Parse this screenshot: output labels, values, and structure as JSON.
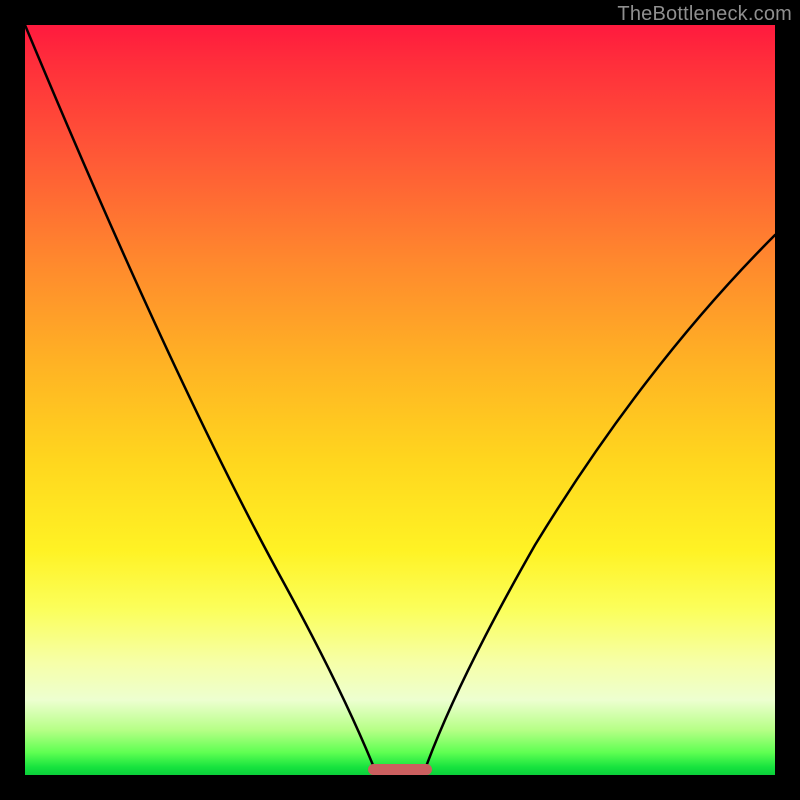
{
  "watermark": "TheBottleneck.com",
  "chart_data": {
    "type": "line",
    "title": "",
    "xlabel": "",
    "ylabel": "",
    "xlim": [
      0,
      100
    ],
    "ylim": [
      0,
      100
    ],
    "grid": false,
    "legend": false,
    "gradient_colors_top_to_bottom": [
      "#ff1a3e",
      "#ff8a2d",
      "#ffd61e",
      "#f6ffa8",
      "#15e23e"
    ],
    "series": [
      {
        "name": "left-curve",
        "x": [
          0,
          5,
          10,
          15,
          20,
          25,
          30,
          35,
          40,
          43,
          45,
          47
        ],
        "values": [
          100,
          88,
          76,
          64,
          53,
          42,
          32,
          22,
          12,
          6,
          2,
          0
        ]
      },
      {
        "name": "right-curve",
        "x": [
          53,
          55,
          58,
          62,
          68,
          75,
          82,
          90,
          98,
          100
        ],
        "values": [
          0,
          4,
          10,
          18,
          30,
          42,
          52,
          62,
          70,
          72
        ]
      }
    ],
    "marker": {
      "x_start": 46,
      "x_end": 54,
      "y": 0,
      "color": "#cb5f5f"
    }
  },
  "interaction": {
    "plot_interactable": false,
    "marker_interactable": false
  }
}
